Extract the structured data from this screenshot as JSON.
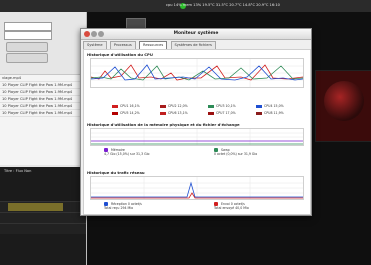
{
  "top_panel": {
    "status_text": "cpu 14% mem 13% 19.5°C 31.5°C 20.7°C 14.8°C 20.9°C 16:10"
  },
  "desktop": {
    "icon_label": "Ubuntu Mono"
  },
  "left_app": {
    "list_items": [
      "vlage.mp4",
      "10 Player CLIP Fight the Pow 1.9M.mp4",
      "10 Player CLIP Fight the Pow 1.9M.mp4",
      "10 Player CLIP Fight the Pow 1.9M.mp4",
      "10 Player CLIP Fight the Pow 1.9M.mp4",
      "10 Player CLIP Fight the Pow 1.9M.mp4"
    ],
    "timeline_title": "Titre : Flux Non"
  },
  "window": {
    "title": "Moniteur système",
    "tabs": [
      {
        "label": "Système"
      },
      {
        "label": "Processus"
      },
      {
        "label": "Ressources",
        "active": true
      },
      {
        "label": "Systèmes de fichiers"
      }
    ]
  },
  "sections": {
    "cpu_title": "Historique d'utilisation du CPU",
    "mem_title": "Historique d'utilisation de la mémoire physique et du fichier d'échange",
    "net_title": "Historique du trafic réseau"
  },
  "cpu_legend": [
    {
      "label": "CPU1 16,1%",
      "color": "#d11f1f"
    },
    {
      "label": "CPU2 12,0%",
      "color": "#a71c1c"
    },
    {
      "label": "CPU3 10,1%",
      "color": "#2e8b57"
    },
    {
      "label": "CPU4 15,0%",
      "color": "#1f4fd1"
    },
    {
      "label": "CPU5 14,2%",
      "color": "#b30000"
    },
    {
      "label": "CPU6 13,1%",
      "color": "#c02020"
    },
    {
      "label": "CPU7 17,0%",
      "color": "#9b1111"
    },
    {
      "label": "CPU8 11,9%",
      "color": "#8a1c1c"
    }
  ],
  "mem_legend": {
    "memory_label": "Mémoire",
    "memory_value": "4,7 Gio (15,0%) sur 31,3 Gio",
    "swap_label": "Swap",
    "swap_value": "0 octet (0,0%) sur 31,9 Gio"
  },
  "net_legend": {
    "rx_label": "Réception",
    "rx_total": "Total reçu",
    "rx_value": "0 octet/s",
    "rx_total_value": "294 Mio",
    "tx_label": "Envoi",
    "tx_total": "Total envoyé",
    "tx_value": "0 octet/s",
    "tx_total_value": "40,0 Mio"
  },
  "colors": {
    "accent_green": "#2bbd2b",
    "accent_red": "#d11f1f"
  }
}
